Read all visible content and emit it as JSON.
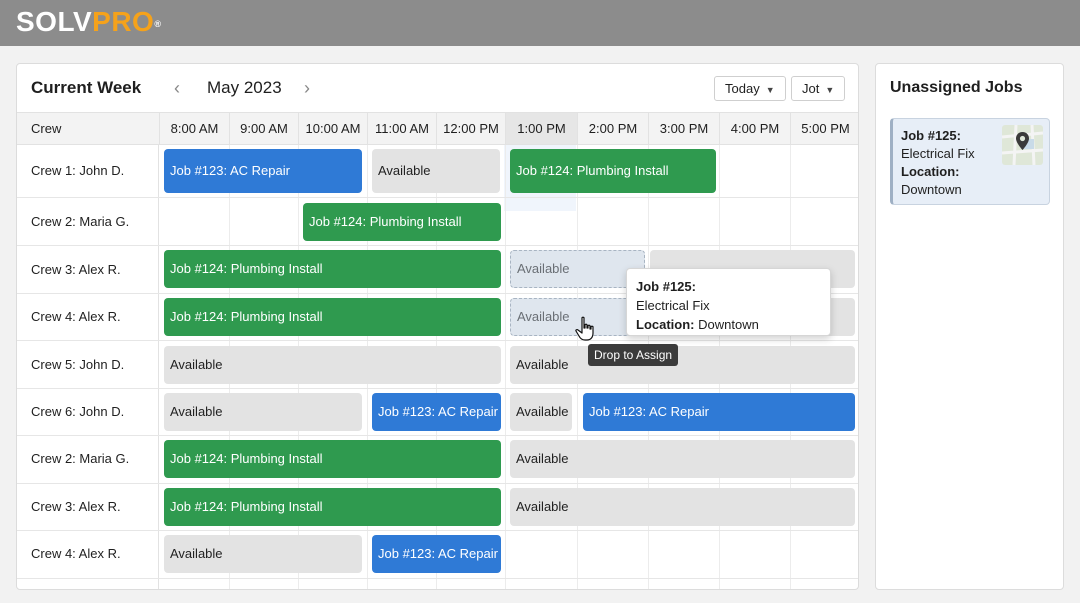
{
  "brand": {
    "logo_white": "SOLV",
    "logo_orange": "PRO",
    "logo_mark": "®",
    "accent": "#f5a21b"
  },
  "header": {
    "title": "Current Week",
    "month": "May 2023",
    "today_label": "Today",
    "view_label": "Jot",
    "prev_icon": "chevron-left-icon",
    "next_icon": "chevron-right-icon"
  },
  "columns": {
    "crew": "Crew",
    "times": [
      "8:00 AM",
      "9:00 AM",
      "10:00 AM",
      "11:00 AM",
      "12:00 PM",
      "1:00 PM",
      "2:00 PM",
      "3:00 PM",
      "4:00 PM",
      "5:00 PM"
    ]
  },
  "crews": [
    "Crew 1: John D.",
    "Crew 2: Maria G.",
    "Crew 3: Alex R.",
    "Crew 4: Alex R.",
    "Crew 5: John D.",
    "Crew 6: John D.",
    "Crew 2: Maria G.",
    "Crew 3: Alex R.",
    "Crew 4: Alex R."
  ],
  "labels": {
    "ac_repair": "Job #123: AC Repair",
    "plumbing": "Job #124: Plumbing Install",
    "available": "Available"
  },
  "colors": {
    "ac_repair": "#2f7ad6",
    "plumbing": "#2f9a4f",
    "available": "#e3e3e3"
  },
  "tooltip": {
    "job": "Job #125:",
    "name": "Electrical Fix",
    "location_label": "Location:",
    "location": "Downtown",
    "drop_hint": "Drop to Assign"
  },
  "sidebar": {
    "title": "Unassigned Jobs",
    "card": {
      "job": "Job #125:",
      "name": "Electrical Fix",
      "location_label": "Location:",
      "location": "Downtown",
      "icon": "map-pin-icon"
    }
  }
}
